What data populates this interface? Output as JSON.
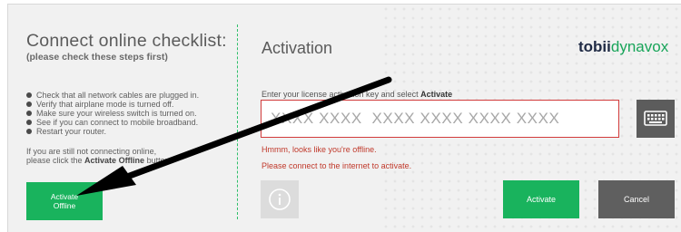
{
  "left": {
    "title": "Connect online checklist:",
    "subtitle": "(please check these steps first)",
    "checklist": [
      "Check that all network cables are plugged in.",
      "Verify that airplane mode is turned off.",
      "Make sure your wireless switch is turned on.",
      "See if you can connect to mobile broadband.",
      "Restart your router."
    ],
    "note_line1": "If you are still not connecting online,",
    "note_line2_prefix": "please click the ",
    "note_line2_bold": "Activate Offline",
    "note_line2_suffix": " button.",
    "activate_offline_line1": "Activate",
    "activate_offline_line2": "Offline"
  },
  "activation": {
    "title": "Activation",
    "instruction_prefix": "Enter your license activation key and select ",
    "instruction_bold": "Activate",
    "key_placeholder": "XXXX XXXX  XXXX XXXX XXXX XXXX",
    "error_offline": "Hmmm, looks like you're offline.",
    "error_connect": "Please connect to the internet to activate.",
    "activate_label": "Activate",
    "cancel_label": "Cancel"
  },
  "logo": {
    "part1": "tobii",
    "part2": "dynavox"
  },
  "icons": {
    "keyboard": "keyboard-icon",
    "info": "info-icon",
    "arrow": "arrow-annotation"
  },
  "colors": {
    "accent_green": "#19b35d",
    "error_red": "#c0392b",
    "dark_button": "#5f5f5f",
    "logo_navy": "#1f2a44"
  }
}
